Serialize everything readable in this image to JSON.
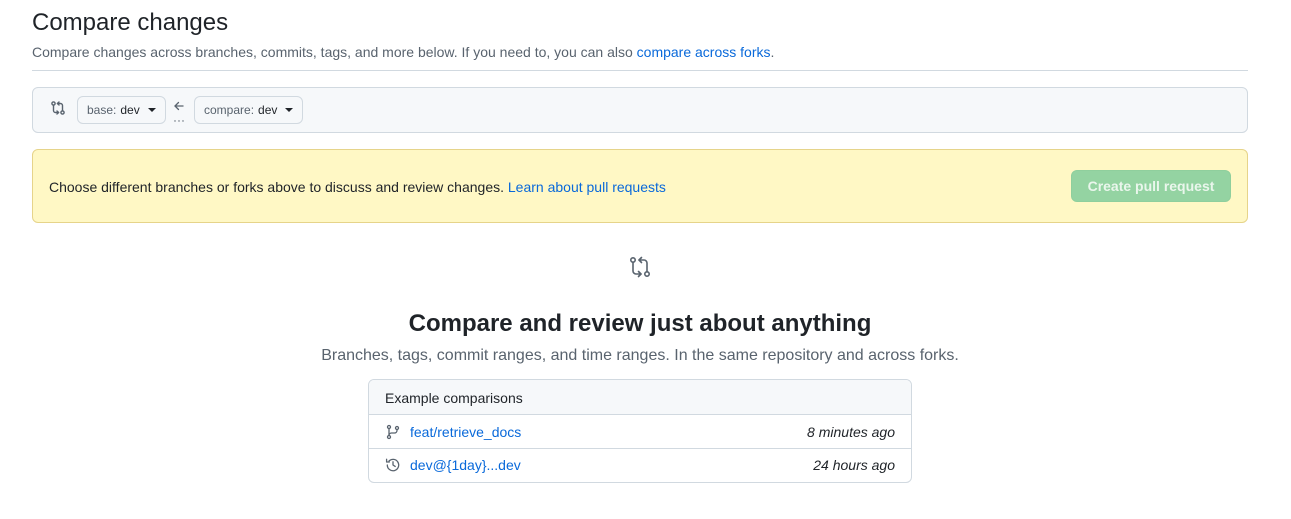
{
  "header": {
    "title": "Compare changes",
    "subtitle_prefix": "Compare changes across branches, commits, tags, and more below. If you need to, you can also ",
    "subtitle_link": "compare across forks",
    "subtitle_suffix": "."
  },
  "range": {
    "icon": "git-compare-icon",
    "base_label": "base:",
    "base_value": "dev",
    "arrow_icon": "arrow-left-icon",
    "compare_label": "compare:",
    "compare_value": "dev"
  },
  "flash": {
    "message": "Choose different branches or forks above to discuss and review changes. ",
    "link": "Learn about pull requests",
    "button": "Create pull request"
  },
  "blankslate": {
    "icon": "git-compare-icon",
    "title": "Compare and review just about anything",
    "subtitle": "Branches, tags, commit ranges, and time ranges. In the same repository and across forks."
  },
  "examples": {
    "heading": "Example comparisons",
    "rows": [
      {
        "icon": "git-branch-icon",
        "label": "feat/retrieve_docs",
        "time": "8 minutes ago"
      },
      {
        "icon": "history-icon",
        "label": "dev@{1day}...dev",
        "time": "24 hours ago"
      }
    ]
  },
  "colors": {
    "link": "#0969da",
    "flash_bg": "#fff8c5",
    "button_disabled": "#94d3a2"
  }
}
